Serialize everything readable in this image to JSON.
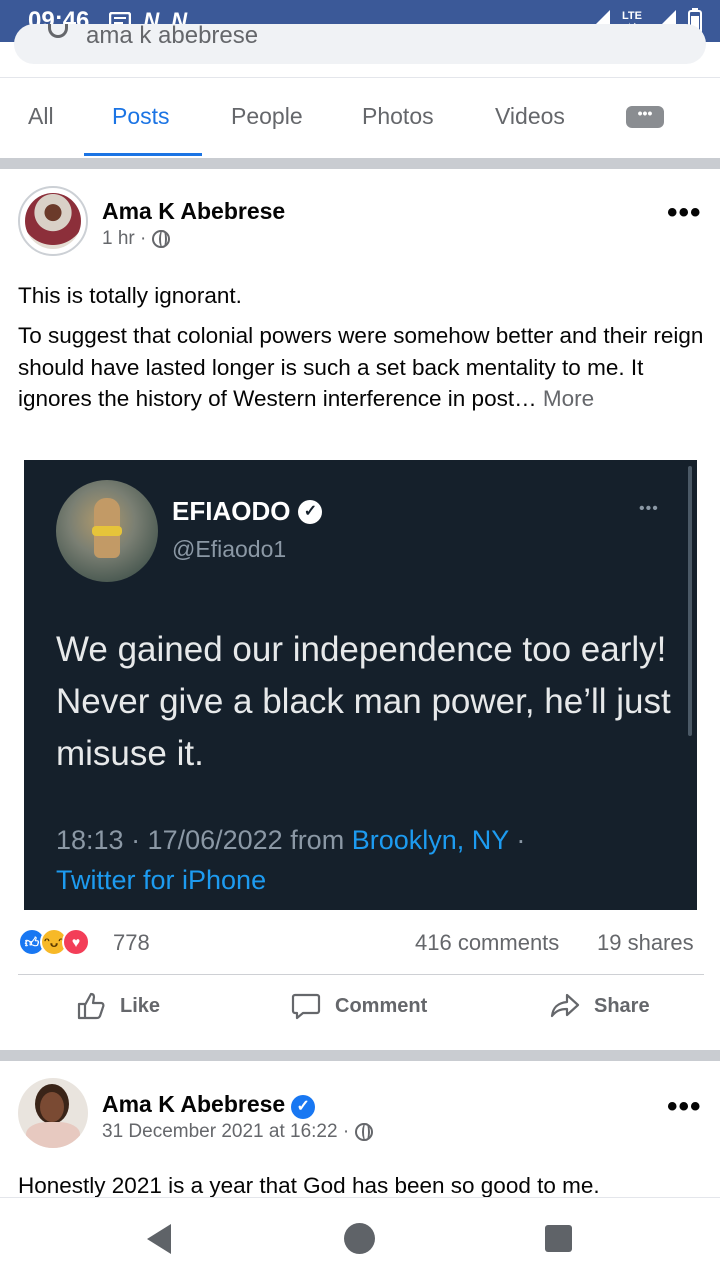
{
  "status_bar": {
    "time": "09:46",
    "network": "LTE"
  },
  "search": {
    "query": "ama k abebrese"
  },
  "tabs": [
    {
      "label": "All"
    },
    {
      "label": "Posts"
    },
    {
      "label": "People"
    },
    {
      "label": "Photos"
    },
    {
      "label": "Videos"
    }
  ],
  "post1": {
    "author": "Ama K Abebrese",
    "time": "1 hr ·",
    "line1": "This is totally ignorant.",
    "body": "To suggest that colonial powers were somehow better and their reign should have lasted longer is such a set back mentality to me. It ignores the history of Western interference in post…",
    "more_label": "More",
    "tweet": {
      "name": "EFIAODO",
      "handle": "@Efiaodo1",
      "text": "We gained our independence too early! Never give a black man power, he’ll just misuse it.",
      "timestamp": "18:13 · 17/06/2022 from",
      "location": "Brooklyn, NY",
      "separator": "·",
      "client": "Twitter for iPhone"
    },
    "reaction_count": "778",
    "comments": "416 comments",
    "shares": "19 shares",
    "actions": {
      "like": "Like",
      "comment": "Comment",
      "share": "Share"
    }
  },
  "post2": {
    "author": "Ama K Abebrese",
    "time": "31 December 2021 at 16:22 ·",
    "text": "Honestly 2021 is a year that God has been so good to me."
  }
}
